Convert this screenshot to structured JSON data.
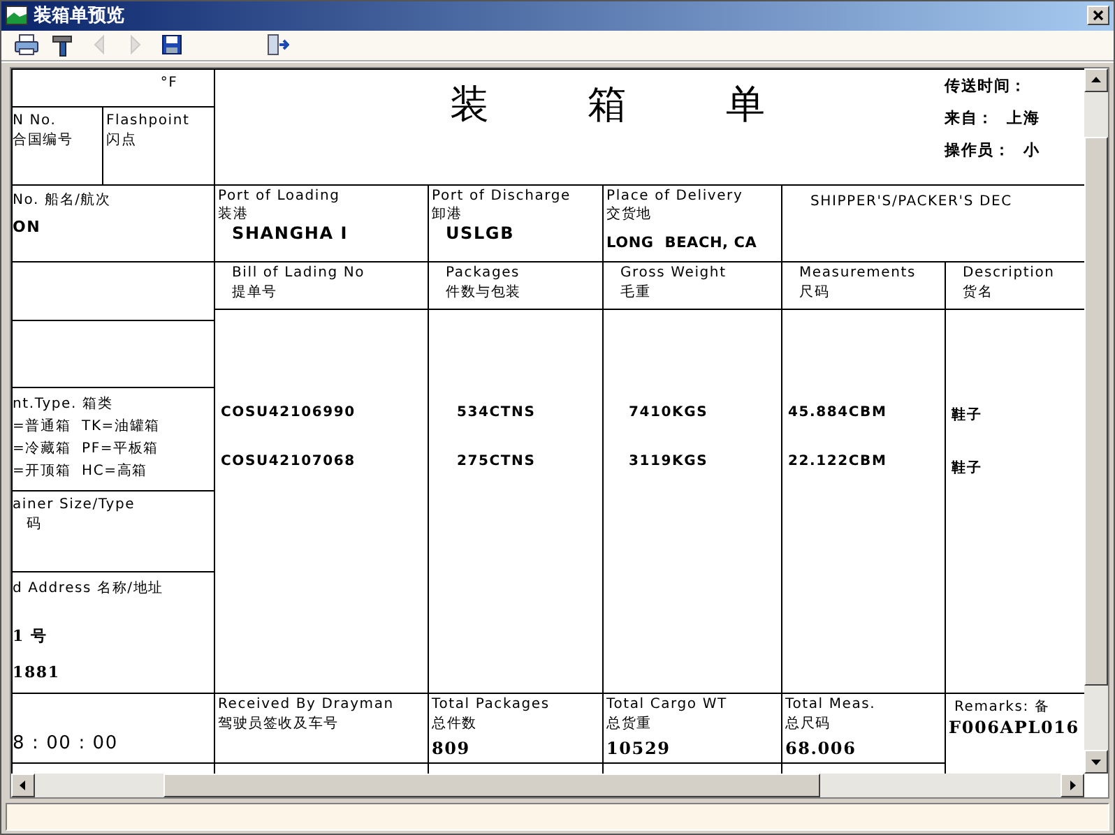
{
  "window": {
    "title": "装箱单预览"
  },
  "toolbar": [
    {
      "kind": "print",
      "disabled": false
    },
    {
      "kind": "tools",
      "disabled": false
    },
    {
      "kind": "previous",
      "disabled": true
    },
    {
      "kind": "next",
      "disabled": true
    },
    {
      "kind": "save",
      "disabled": false
    },
    {
      "kind": "exit",
      "disabled": false
    }
  ],
  "document": {
    "temperature_unit": "°F",
    "un_no": {
      "label": "N No.",
      "label_cn": "合国编号"
    },
    "flashpoint": {
      "label": "Flashpoint",
      "label_cn": "闪点"
    },
    "title_chars": [
      "装",
      "箱",
      "单"
    ],
    "header_info": [
      {
        "label": "传送时间："
      },
      {
        "label": "来自：",
        "value": "上海"
      },
      {
        "label": "操作员：",
        "value": "小"
      }
    ],
    "vessel": {
      "label": "No. 船名/航次",
      "value": "ON"
    },
    "ports": [
      {
        "label": "Port of Loading",
        "label_cn": "装港",
        "value": "SHANGHA I"
      },
      {
        "label": "Port of Discharge",
        "label_cn": "卸港",
        "value": "USLGB"
      },
      {
        "label": "Place of Delivery",
        "label_cn": "交货地",
        "value": "LONG  BEACH, CA"
      }
    ],
    "declaration": "SHIPPER'S/PACKER'S DEC",
    "columns": [
      {
        "label": "Bill of Lading No",
        "label_cn": "提单号"
      },
      {
        "label": "Packages",
        "label_cn": "件数与包装"
      },
      {
        "label": "Gross Weight",
        "label_cn": "毛重"
      },
      {
        "label": "Measurements",
        "label_cn": "尺码"
      },
      {
        "label": "Description",
        "label_cn": "货名"
      }
    ],
    "rows": [
      [
        "COSU42106990",
        "534CTNS",
        "7410KGS",
        "45.884CBM",
        "鞋子"
      ],
      [
        "COSU42107068",
        "275CTNS",
        "3119KGS",
        "22.122CBM",
        "鞋子"
      ]
    ],
    "cont_type": {
      "label": "nt.Type. 箱类",
      "lines": [
        "=普通箱  TK=油罐箱",
        "=冷藏箱  PF=平板箱",
        "=开顶箱  HC=高箱"
      ]
    },
    "container_size": {
      "label": "ainer Size/Type",
      "label_cn": "码"
    },
    "address": {
      "label": "d Address 名称/地址",
      "lines": [
        "1 号",
        "1881"
      ]
    },
    "time": "8 : 00 : 00",
    "totals": [
      {
        "label": "Received By Drayman",
        "label_cn": "驾驶员签收及车号"
      },
      {
        "label": "Total Packages",
        "label_cn": "总件数",
        "value": "809"
      },
      {
        "label": "Total Cargo WT",
        "label_cn": "总货重",
        "value": "10529"
      },
      {
        "label": "Total Meas.",
        "label_cn": "总尺码",
        "value": "68.006"
      }
    ],
    "remarks": {
      "label": "Remarks: 备",
      "value": "F006APL016"
    }
  }
}
